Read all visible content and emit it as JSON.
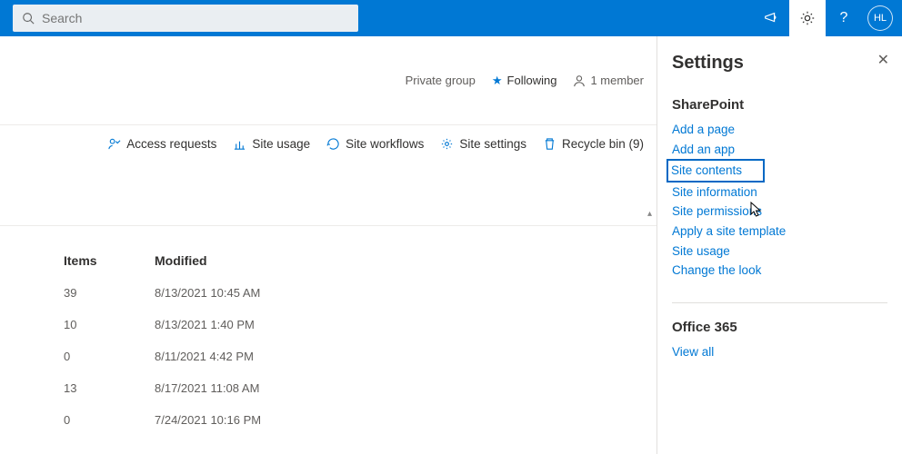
{
  "search": {
    "placeholder": "Search"
  },
  "avatar_initials": "HL",
  "site_meta": {
    "group": "Private group",
    "following": "Following",
    "members": "1 member"
  },
  "cmdbar": {
    "access_requests": "Access requests",
    "site_usage": "Site usage",
    "site_workflows": "Site workflows",
    "site_settings": "Site settings",
    "recycle_bin": "Recycle bin (9)"
  },
  "table": {
    "head_items": "Items",
    "head_modified": "Modified",
    "rows": [
      {
        "items": "39",
        "modified": "8/13/2021 10:45 AM"
      },
      {
        "items": "10",
        "modified": "8/13/2021 1:40 PM"
      },
      {
        "items": "0",
        "modified": "8/11/2021 4:42 PM"
      },
      {
        "items": "13",
        "modified": "8/17/2021 11:08 AM"
      },
      {
        "items": "0",
        "modified": "7/24/2021 10:16 PM"
      }
    ]
  },
  "panel": {
    "title": "Settings",
    "sp_heading": "SharePoint",
    "links": {
      "add_page": "Add a page",
      "add_app": "Add an app",
      "site_contents": "Site contents",
      "site_information": "Site information",
      "site_permissions": "Site permissions",
      "apply_template": "Apply a site template",
      "site_usage": "Site usage",
      "change_look": "Change the look"
    },
    "o365_heading": "Office 365",
    "view_all": "View all"
  }
}
